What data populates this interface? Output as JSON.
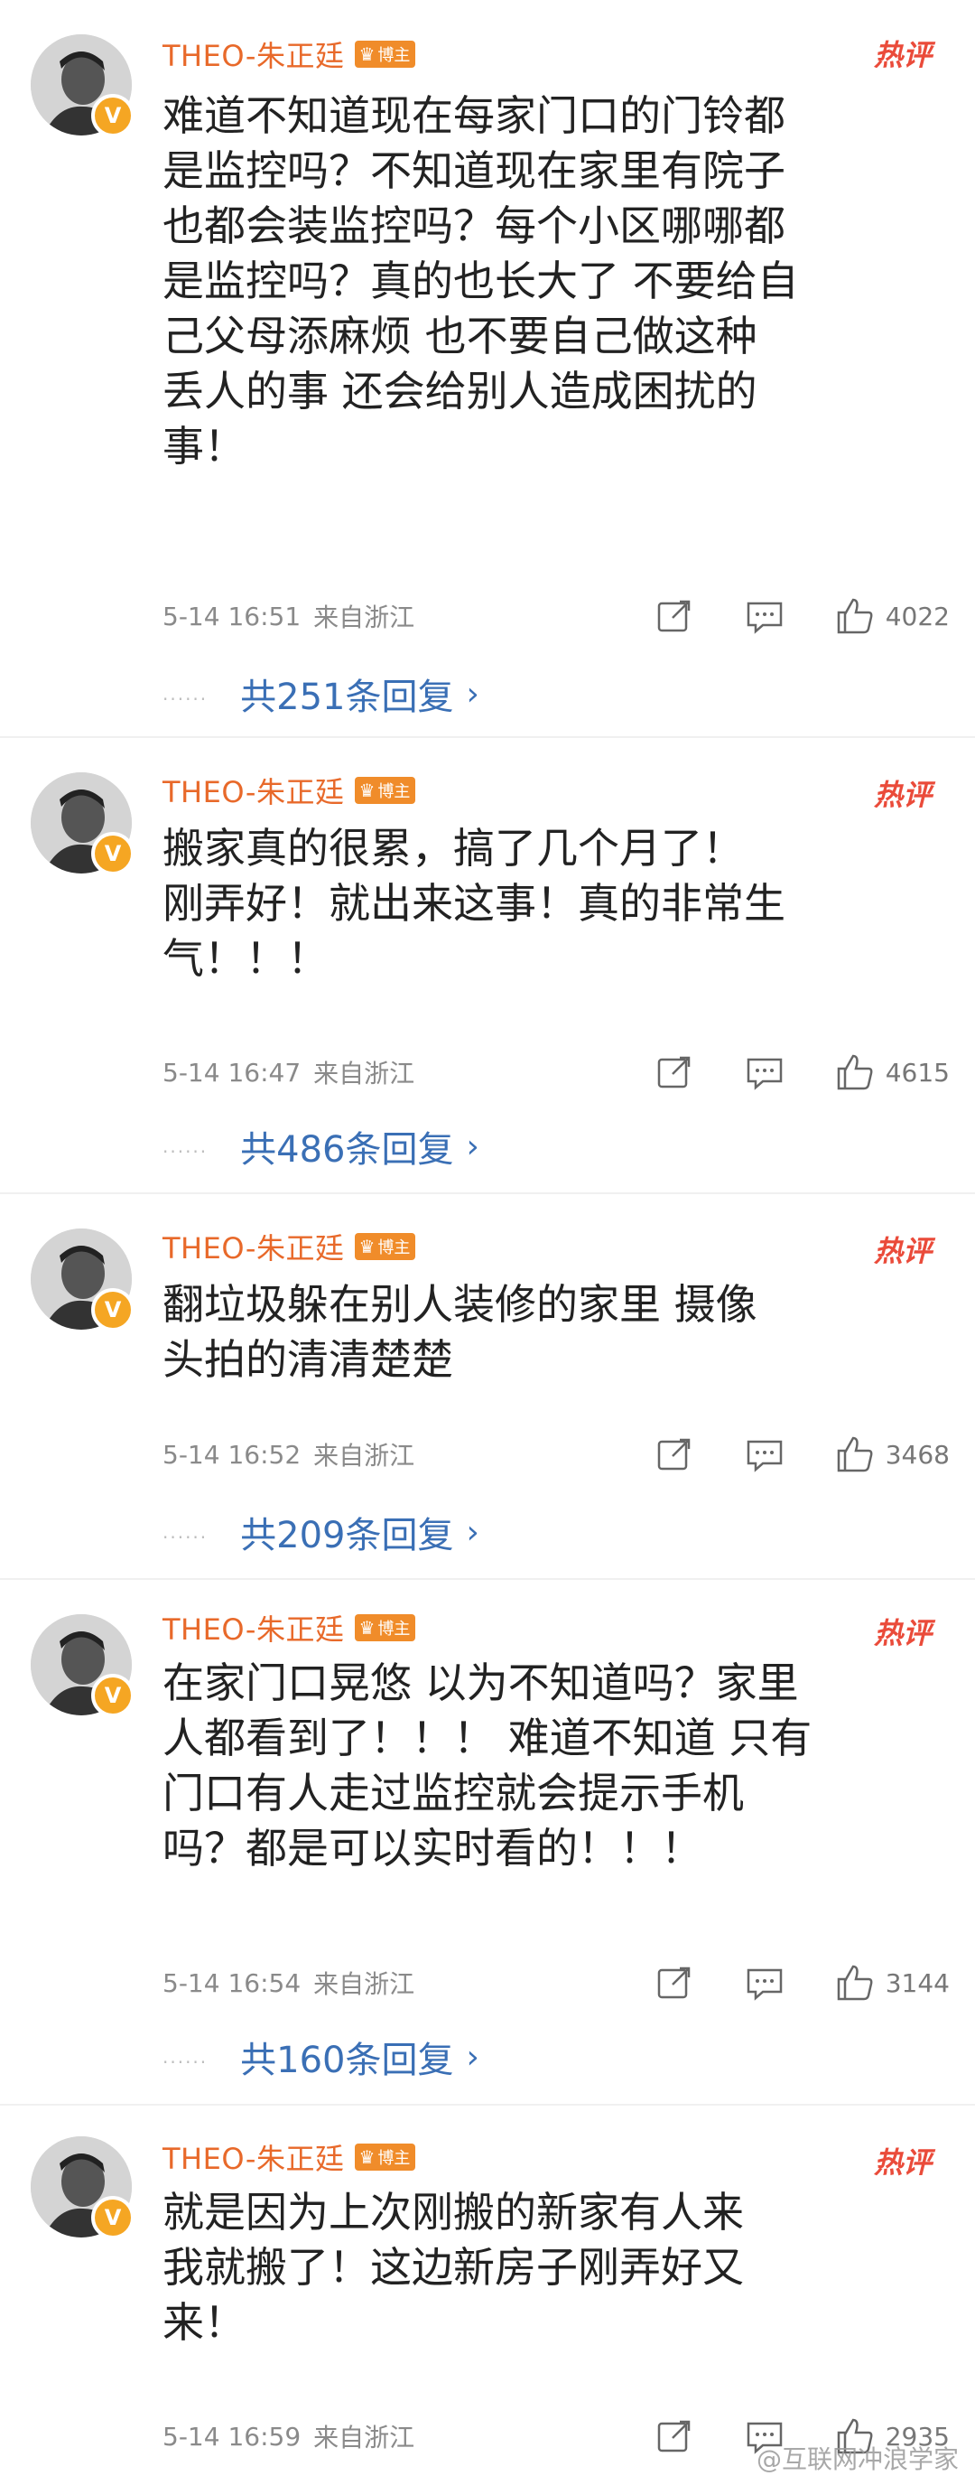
{
  "comments": [
    {
      "username": "THEO-朱正廷",
      "badge": "博主",
      "hot_tag": "热评",
      "lines": "难道不知道现在每家门口的门铃都\n是监控吗？不知道现在家里有院子\n也都会装监控吗？每个小区哪哪都\n是监控吗？真的也长大了 不要给自\n己父母添麻烦 也不要自己做这种\n丢人的事 还会给别人造成困扰的\n事！",
      "time": "5-14 16:51",
      "location": "来自浙江",
      "likes": "4022",
      "replies": "共251条回复"
    },
    {
      "username": "THEO-朱正廷",
      "badge": "博主",
      "hot_tag": "热评",
      "lines": "搬家真的很累，搞了几个月了！\n刚弄好！就出来这事！真的非常生\n气！！！",
      "time": "5-14 16:47",
      "location": "来自浙江",
      "likes": "4615",
      "replies": "共486条回复"
    },
    {
      "username": "THEO-朱正廷",
      "badge": "博主",
      "hot_tag": "热评",
      "lines": "翻垃圾躲在别人装修的家里 摄像\n头拍的清清楚楚",
      "time": "5-14 16:52",
      "location": "来自浙江",
      "likes": "3468",
      "replies": "共209条回复"
    },
    {
      "username": "THEO-朱正廷",
      "badge": "博主",
      "hot_tag": "热评",
      "lines": "在家门口晃悠 以为不知道吗？家里\n人都看到了！！！ 难道不知道 只有\n门口有人走过监控就会提示手机\n吗？都是可以实时看的！！！",
      "time": "5-14 16:54",
      "location": "来自浙江",
      "likes": "3144",
      "replies": "共160条回复"
    },
    {
      "username": "THEO-朱正廷",
      "badge": "博主",
      "hot_tag": "热评",
      "lines": "就是因为上次刚搬的新家有人来\n我就搬了！这边新房子刚弄好又\n来！",
      "time": "5-14 16:59",
      "location": "来自浙江",
      "likes": "2935",
      "replies": ""
    }
  ],
  "watermark": "@互联网冲浪学家",
  "colors": {
    "username": "#e8692a",
    "link": "#3a6fb5",
    "hot": "#ea4b3a",
    "badge": "#f08c2a"
  },
  "icons": {
    "verified": "V",
    "share": "share-icon",
    "comment": "comment-icon",
    "like": "thumbs-up-icon"
  }
}
